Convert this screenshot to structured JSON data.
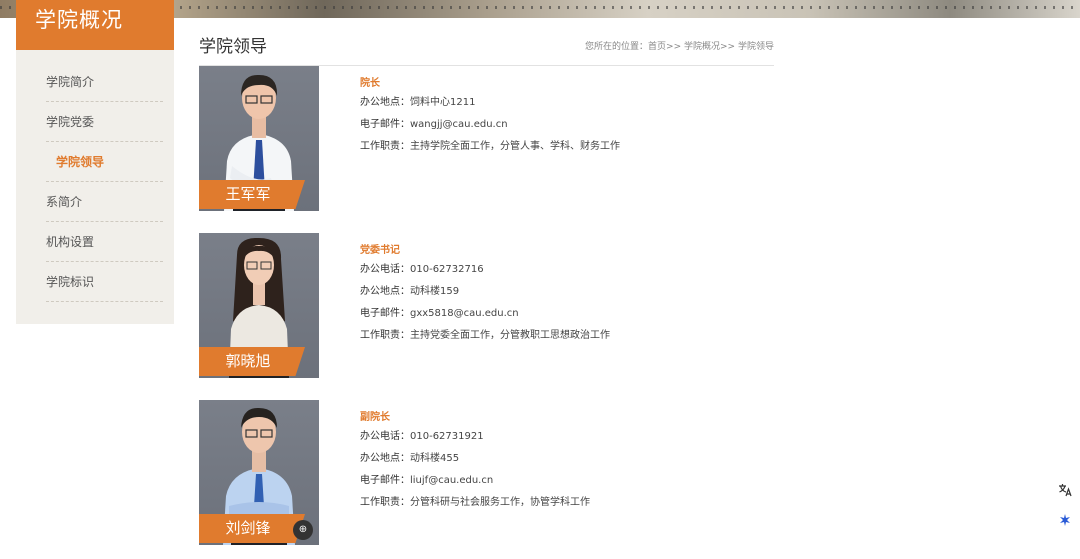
{
  "sidebar": {
    "title": "学院概况",
    "items": [
      {
        "label": "学院简介",
        "active": false
      },
      {
        "label": "学院党委",
        "active": false
      },
      {
        "label": "学院领导",
        "active": true
      },
      {
        "label": "系简介",
        "active": false
      },
      {
        "label": "机构设置",
        "active": false
      },
      {
        "label": "学院标识",
        "active": false
      }
    ]
  },
  "main": {
    "title": "学院领导",
    "breadcrumb": {
      "prefix": "您所在的位置：",
      "home": "首页",
      "sep1": ">>",
      "level1": "学院概况",
      "sep2": ">>",
      "current": "学院领导"
    }
  },
  "leaders": [
    {
      "name": "王军军",
      "role": "院长",
      "rows": [
        {
          "label": "办公地点：",
          "value": "饲料中心1211"
        },
        {
          "label": "电子邮件：",
          "value": "wangjj@cau.edu.cn"
        },
        {
          "label": "工作职责：",
          "value": "主持学院全面工作，分管人事、学科、财务工作"
        }
      ]
    },
    {
      "name": "郭晓旭",
      "role": "党委书记",
      "rows": [
        {
          "label": "办公电话：",
          "value": "010-62732716"
        },
        {
          "label": "办公地点：",
          "value": "动科楼159"
        },
        {
          "label": "电子邮件：",
          "value": "gxx5818@cau.edu.cn"
        },
        {
          "label": "工作职责：",
          "value": "主持党委全面工作，分管教职工思想政治工作"
        }
      ]
    },
    {
      "name": "刘剑锋",
      "role": "副院长",
      "rows": [
        {
          "label": "办公电话：",
          "value": "010-62731921"
        },
        {
          "label": "办公地点：",
          "value": "动科楼455"
        },
        {
          "label": "电子邮件：",
          "value": "liujf@cau.edu.cn"
        },
        {
          "label": "工作职责：",
          "value": "分管科研与社会服务工作，协管学科工作"
        }
      ]
    }
  ],
  "colors": {
    "accent": "#e07b2e",
    "sidebar_bg": "#f1efea"
  },
  "icons": {
    "photo_fab": "image-search-icon",
    "float_1": "translate-icon",
    "float_2": "assistant-icon"
  }
}
